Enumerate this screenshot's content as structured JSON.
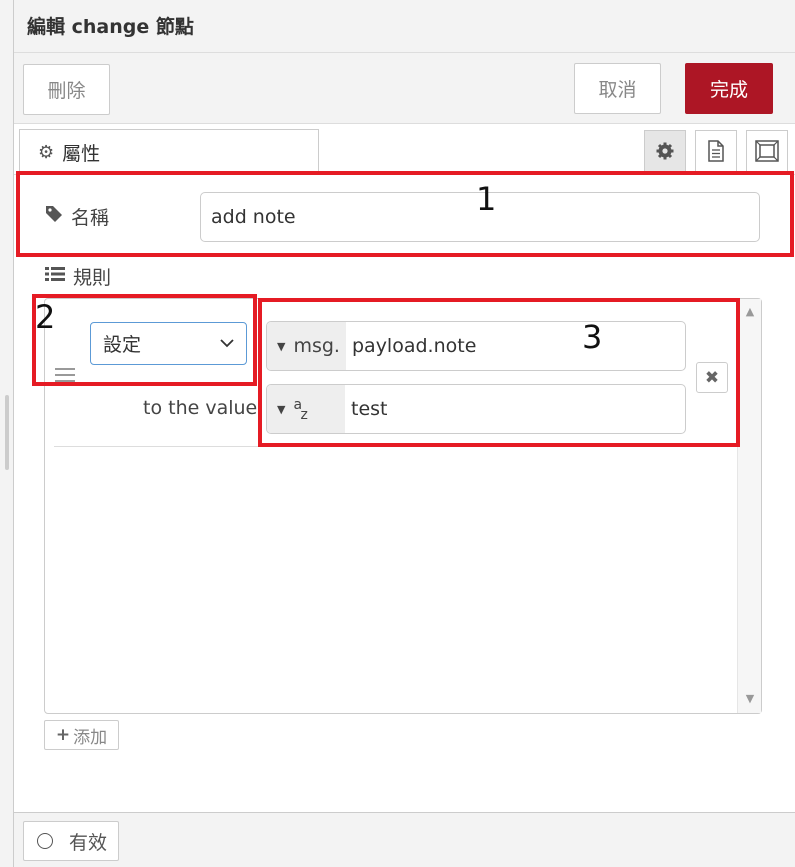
{
  "header": {
    "title": "編輯 change 節點"
  },
  "buttons": {
    "delete": "刪除",
    "cancel": "取消",
    "done": "完成"
  },
  "tabs": {
    "properties": "屬性"
  },
  "form": {
    "name_label": "名稱",
    "name_value": "add note",
    "rules_label": "規則"
  },
  "rule": {
    "action": "設定",
    "target_type": "msg.",
    "target_value": "payload.note",
    "to_label": "to the value",
    "value_type": "az",
    "value": "test"
  },
  "add_button": "添加",
  "footer": {
    "enabled": "有效"
  },
  "annotations": [
    "1",
    "2",
    "3"
  ],
  "colors": {
    "done_button": "#ad1625",
    "annotation": "#e51b24"
  },
  "icons": [
    "gear-icon",
    "document-icon",
    "frame-icon",
    "tag-icon",
    "list-icon",
    "close-icon",
    "plus-icon",
    "drag-handle-icon"
  ]
}
